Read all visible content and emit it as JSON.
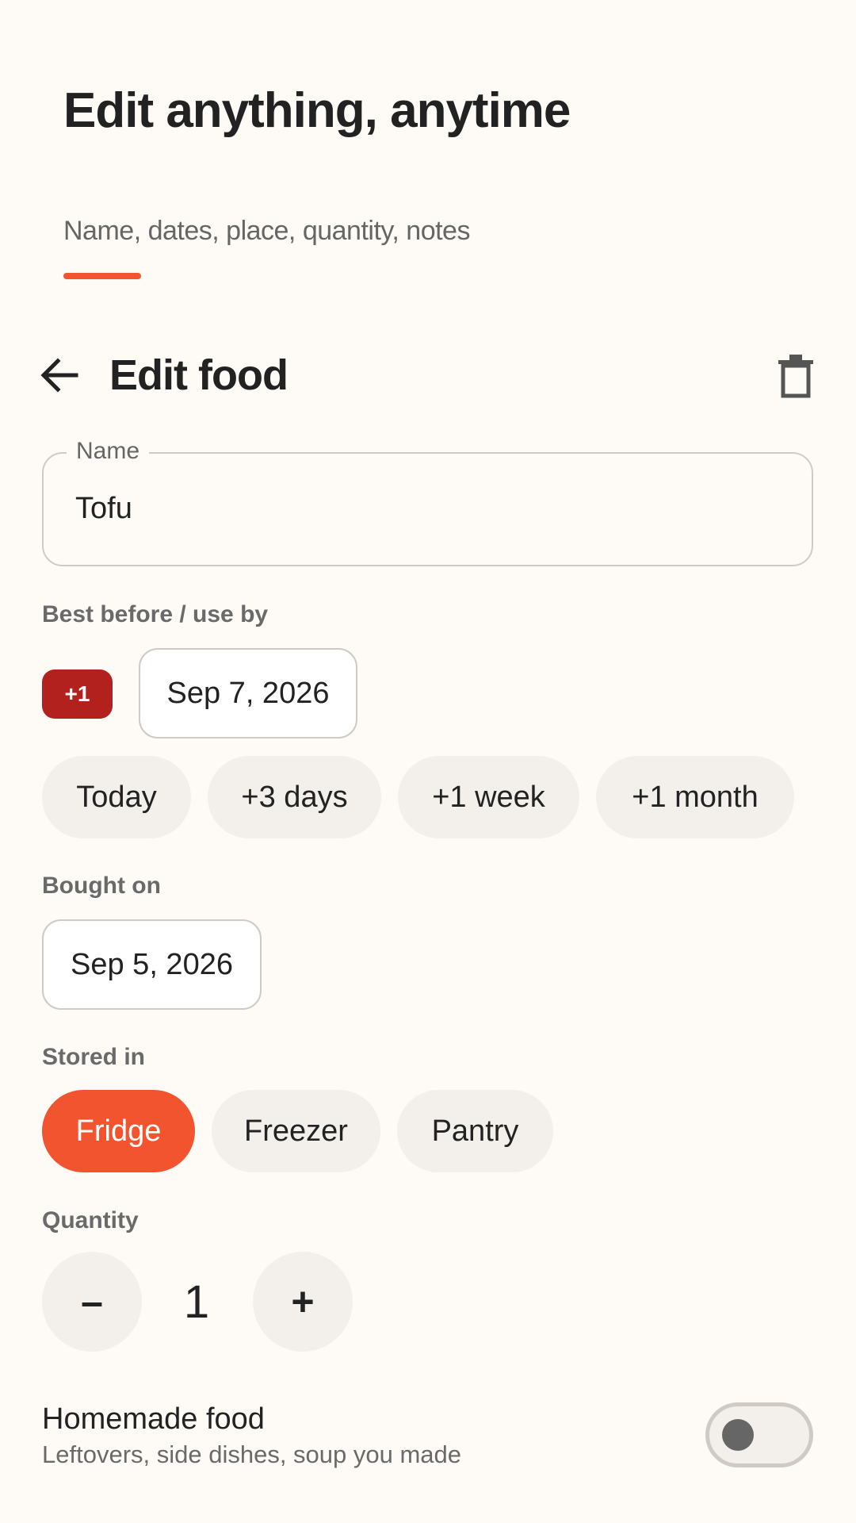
{
  "promo": {
    "title": "Edit anything, anytime",
    "subtitle": "Name, dates, place, quantity, notes",
    "accent_color": "#f25430"
  },
  "app_bar": {
    "back_icon": "arrow-left-icon",
    "title": "Edit food",
    "delete_icon": "trash-icon"
  },
  "name_field": {
    "label": "Name",
    "value": "Tofu"
  },
  "expiry": {
    "label": "Best before / use by",
    "badge": "+1",
    "badge_color": "#b3211e",
    "date": "Sep 7, 2026",
    "quick_options": [
      "Today",
      "+3 days",
      "+1 week",
      "+1 month"
    ]
  },
  "bought": {
    "label": "Bought on",
    "date": "Sep 5, 2026"
  },
  "storage": {
    "label": "Stored in",
    "options": [
      "Fridge",
      "Freezer",
      "Pantry"
    ],
    "selected": "Fridge"
  },
  "quantity": {
    "label": "Quantity",
    "decrement": "–",
    "value": "1",
    "increment": "+"
  },
  "homemade": {
    "title": "Homemade food",
    "subtitle": "Leftovers, side dishes, soup you made",
    "enabled": false
  }
}
